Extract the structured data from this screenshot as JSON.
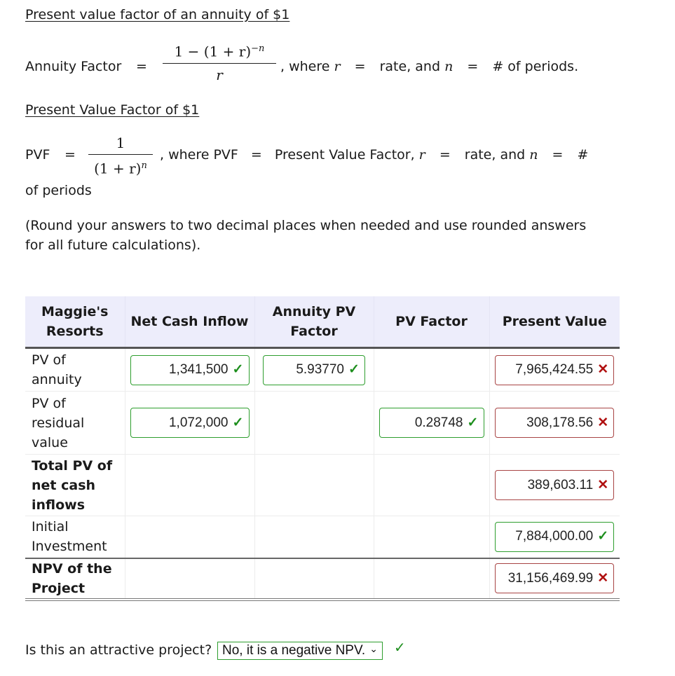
{
  "annuity_section": {
    "heading": "Present value factor of an annuity of $1",
    "label": "Annuity Factor",
    "equals": "=",
    "numerator": "1 − (1 + r)",
    "numerator_exp": "−n",
    "denominator": "r",
    "where": ", where",
    "r": "r",
    "rate": "rate, and",
    "n": "n",
    "periods": "# of periods."
  },
  "pvf_section": {
    "heading": "Present Value Factor of $1",
    "label": "PVF",
    "equals": "=",
    "numerator": "1",
    "denominator": "(1 + r)",
    "denominator_exp": "n",
    "where": ", where PVF",
    "pvf_def": "Present Value Factor,",
    "r": "r",
    "rate": "rate, and",
    "n": "n",
    "hash": "#",
    "continuation": "of periods"
  },
  "instructions": {
    "line1": "(Round your answers to two decimal places when needed and use rounded answers",
    "line2": "for all future calculations)."
  },
  "table": {
    "headers": {
      "c0_line1": "Maggie's",
      "c0_line2": "Resorts",
      "c1": "Net Cash Inflow",
      "c2_line1": "Annuity PV",
      "c2_line2": "Factor",
      "c3": "PV Factor",
      "c4": "Present Value"
    },
    "rows": [
      {
        "label_line1": "PV of",
        "label_line2": "annuity",
        "net_cash_inflow": "1,341,500",
        "net_cash_inflow_status": "correct",
        "annuity_pv_factor": "5.93770",
        "annuity_pv_factor_status": "correct",
        "present_value": "7,965,424.55",
        "present_value_status": "incorrect"
      },
      {
        "label_line1": "PV of",
        "label_line2": "residual",
        "label_line3": "value",
        "net_cash_inflow": "1,072,000",
        "net_cash_inflow_status": "correct",
        "pv_factor": "0.28748",
        "pv_factor_status": "correct",
        "present_value": "308,178.56",
        "present_value_status": "incorrect"
      },
      {
        "label_line1": "Total PV of",
        "label_line2": "net cash",
        "label_line3": "inflows",
        "present_value": "389,603.11",
        "present_value_status": "incorrect"
      },
      {
        "label_line1": "Initial",
        "label_line2": "Investment",
        "present_value": "7,884,000.00",
        "present_value_status": "correct"
      },
      {
        "label_line1": "NPV of the",
        "label_line2": "Project",
        "present_value": "31,156,469.99",
        "present_value_status": "incorrect"
      }
    ]
  },
  "question": {
    "prompt": "Is this an attractive project?",
    "selected": "No, it is a negative NPV.",
    "status": "correct"
  },
  "icons": {
    "check": "✓",
    "cross": "✕",
    "chevron": "⌄"
  },
  "colors": {
    "correct": "#1e8f1e",
    "incorrect": "#b01010",
    "header_bg": "#ededfb"
  }
}
